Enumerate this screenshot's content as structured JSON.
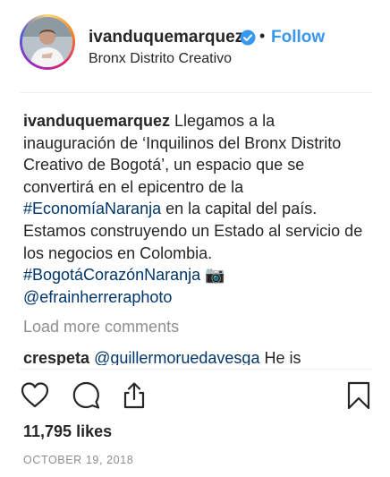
{
  "header": {
    "username": "ivanduquemarquez",
    "separator": "•",
    "follow_label": "Follow",
    "location": "Bronx Distrito Creativo"
  },
  "caption": {
    "username": "ivanduquemarquez",
    "text_1": " Llegamos a la inauguración de ‘Inquilinos del Bronx Distrito Creativo de Bogotá’, un espacio que se convertirá en el epicentro de la ",
    "hashtag_1": "#EconomíaNaranja",
    "text_2": " en la capital del país. Estamos construyendo un Estado al servicio de los negocios en Colombia. ",
    "hashtag_2": "#BogotáCorazónNaranja",
    "emoji": "📷",
    "mention": "@efrainherreraphoto"
  },
  "comments": {
    "load_more_label": "Load more comments",
    "items": [
      {
        "username": "crespeta",
        "mention": "@guillermoruedavesga",
        "text": " He is"
      }
    ]
  },
  "actions": {
    "like_icon": "heart-icon",
    "comment_icon": "comment-icon",
    "share_icon": "share-icon",
    "save_icon": "bookmark-icon"
  },
  "likes": "11,795 likes",
  "date": "OCTOBER 19, 2018",
  "colors": {
    "link": "#3897f0",
    "hashtag": "#003569",
    "muted": "#8e8e8e",
    "text": "#262626"
  }
}
